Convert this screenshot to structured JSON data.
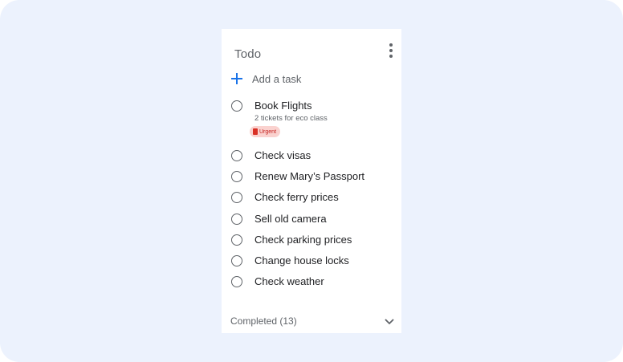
{
  "list": {
    "title": "Todo",
    "menu_icon": "more-vert-icon",
    "add_task_label": "Add a task",
    "add_icon": "plus-icon"
  },
  "tasks": [
    {
      "title": "Book Flights",
      "note": "2 tickets for eco class",
      "tag": "Urgent"
    },
    {
      "title": "Check visas"
    },
    {
      "title": "Renew Mary’s Passport"
    },
    {
      "title": "Check ferry prices"
    },
    {
      "title": "Sell old camera"
    },
    {
      "title": "Check parking prices"
    },
    {
      "title": "Change house locks"
    },
    {
      "title": "Check weather"
    }
  ],
  "completed": {
    "label": "Completed (13)",
    "icon": "chevron-down-icon"
  },
  "colors": {
    "background": "#ecf2fd",
    "accent": "#1a73e8",
    "urgent_bg": "#fad2cf",
    "urgent_fg": "#d93025"
  }
}
